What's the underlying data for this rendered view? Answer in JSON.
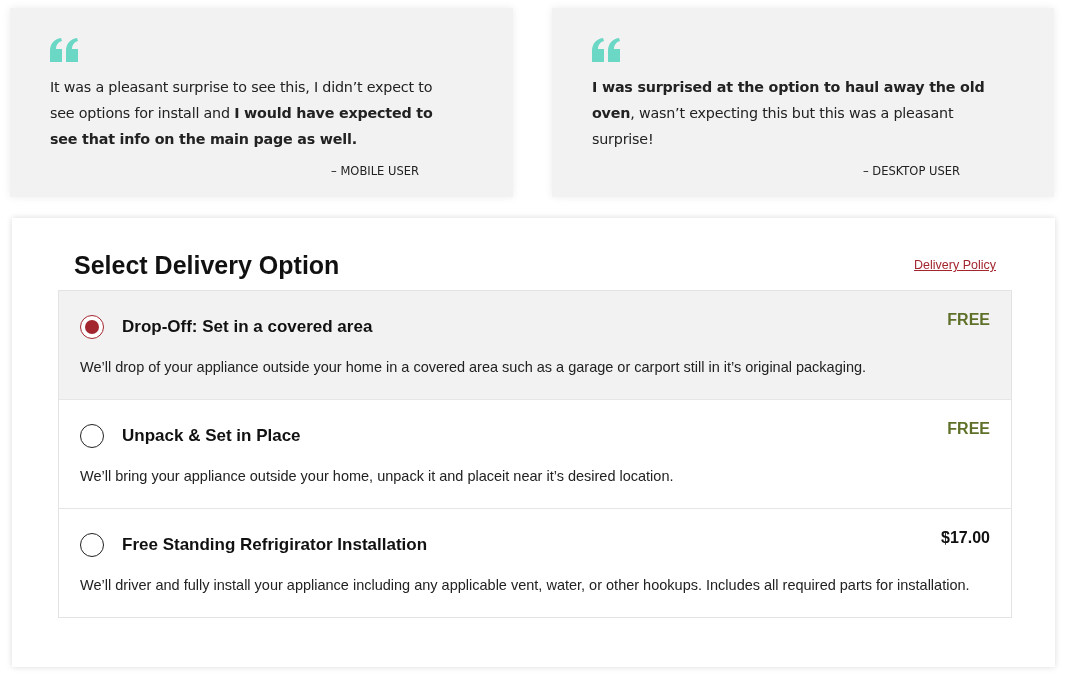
{
  "testimonials": [
    {
      "quote": "It was a pleasant surprise to see this, I didn’t expect to see options for install and **I would have expected to see that info on the main page as well.**",
      "attribution": "– MOBILE USER"
    },
    {
      "quote": "**I was surprised at the option to haul away the old oven**, wasn’t expecting this but this was a pleasant surprise!",
      "attribution": "– DESKTOP USER"
    }
  ],
  "delivery": {
    "title": "Select Delivery Option",
    "policy_link": "Delivery Policy",
    "options": [
      {
        "name": "Drop-Off: Set in a covered area",
        "price": "FREE",
        "kind": "free",
        "selected": true,
        "description": "We’ll drop of your appliance outside your home in a covered area such as a garage or carport still in it’s original packaging."
      },
      {
        "name": "Unpack & Set in Place",
        "price": "FREE",
        "kind": "free",
        "selected": false,
        "description": "We’ll bring your appliance outside your home, unpack it and placeit near it’s desired location."
      },
      {
        "name": "Free Standing Refrigirator Installation",
        "price": "$17.00",
        "kind": "paid",
        "selected": false,
        "description": "We’ll driver and fully install your appliance including any applicable vent, water, or other hookups. Includes all required parts for installation."
      }
    ]
  }
}
